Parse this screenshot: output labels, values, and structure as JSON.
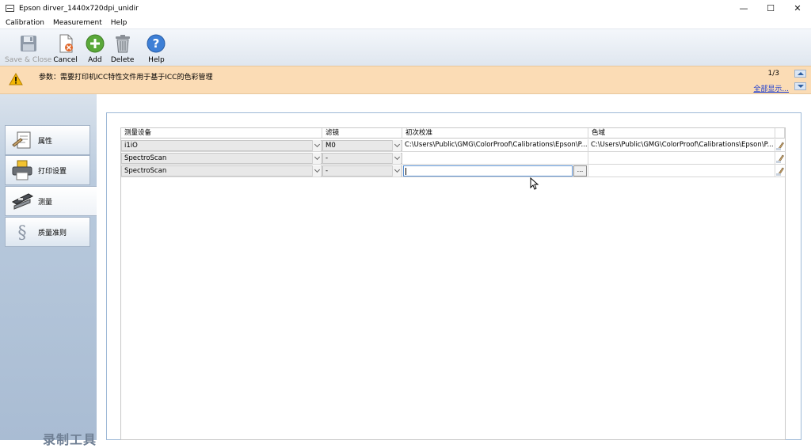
{
  "window": {
    "title": "Epson dirver_1440x720dpi_unidir"
  },
  "menu": [
    "Calibration",
    "Measurement",
    "Help"
  ],
  "toolbar": {
    "save_close": "Save & Close",
    "cancel": "Cancel",
    "add": "Add",
    "delete": "Delete",
    "help": "Help"
  },
  "infobar": {
    "message": "参数：需要打印机ICC特性文件用于基于ICC的色彩管理",
    "page": "1/3",
    "show_all": "全部显示..."
  },
  "sidebar": {
    "items": [
      {
        "label": "属性",
        "icon": "properties-icon"
      },
      {
        "label": "打印设置",
        "icon": "printer-icon"
      },
      {
        "label": "测量",
        "icon": "measure-icon"
      },
      {
        "label": "质量准则",
        "icon": "quality-icon"
      }
    ]
  },
  "grid": {
    "columns": [
      "测量设备",
      "滤镜",
      "初次校准",
      "色域"
    ],
    "rows": [
      {
        "device": "i1iO",
        "filter": "M0",
        "calibration": "C:\\Users\\Public\\GMG\\ColorProof\\Calibrations\\Epson\\P...",
        "gamut": "C:\\Users\\Public\\GMG\\ColorProof\\Calibrations\\Epson\\P..."
      },
      {
        "device": "SpectroScan",
        "filter": "-",
        "calibration": "",
        "gamut": ""
      },
      {
        "device": "SpectroScan",
        "filter": "-",
        "calibration": "",
        "gamut": ""
      }
    ],
    "browse_label": "..."
  },
  "watermark": "录制工具",
  "colors": {
    "infobar": "#fbdcb5",
    "sidebar": "#b9cadd",
    "link": "#1a3bd1"
  }
}
